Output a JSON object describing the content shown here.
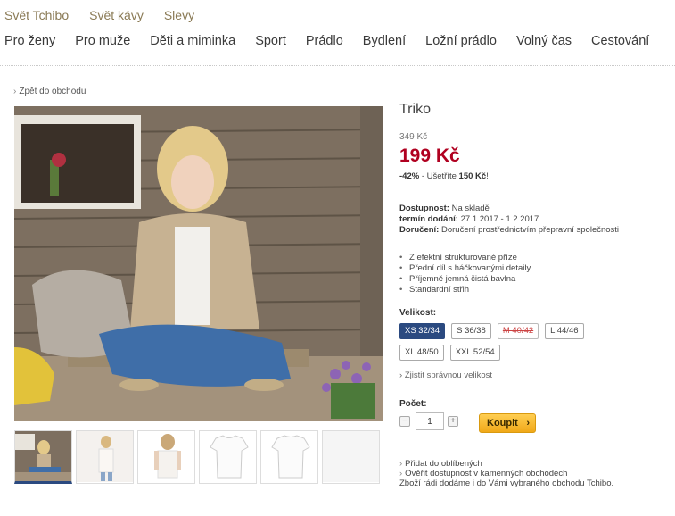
{
  "toplinks": [
    "Svět Tchibo",
    "Svět kávy",
    "Slevy"
  ],
  "mainnav": [
    "Pro ženy",
    "Pro muže",
    "Děti a miminka",
    "Sport",
    "Prádlo",
    "Bydlení",
    "Ložní prádlo",
    "Volný čas",
    "Cestování"
  ],
  "back_link": "Zpět do obchodu",
  "product": {
    "title": "Triko",
    "old_price": "349 Kč",
    "price": "199 Kč",
    "discount_pct": "-42%",
    "save_text": " - Ušetříte ",
    "save_amount": "150 Kč",
    "save_end": "!"
  },
  "info": {
    "availability_label": "Dostupnost:",
    "availability_value": " Na skladě",
    "delivery_date_label": "termín dodání:",
    "delivery_date_value": " 27.1.2017 - 1.2.2017",
    "delivery_label": "Doručení:",
    "delivery_value": " Doručení prostřednictvím přepravní společnosti"
  },
  "features": [
    "Z efektní strukturované příze",
    "Přední díl s háčkovanými detaily",
    "Příjemně jemná čistá bavlna",
    "Standardní střih"
  ],
  "size_label": "Velikost:",
  "sizes": [
    "XS 32/34",
    "S 36/38",
    "M 40/42",
    "L 44/46",
    "XL 48/50",
    "XXL 52/54"
  ],
  "size_help": "Zjistit správnou velikost",
  "qty_label": "Počet:",
  "qty_value": "1",
  "qty_minus": "−",
  "qty_plus": "+",
  "buy_label": "Koupit",
  "buy_arrow": "›",
  "bottom": {
    "favorites": "Přidat do oblíbených",
    "store_check": "Ověřit dostupnost v kamenných obchodech",
    "store_note": "Zboží rádi dodáme i do Vámi vybraného obchodu Tchibo."
  },
  "colors": {
    "accent": "#2b4a80",
    "price": "#b00020",
    "buy": "#f0a818"
  }
}
